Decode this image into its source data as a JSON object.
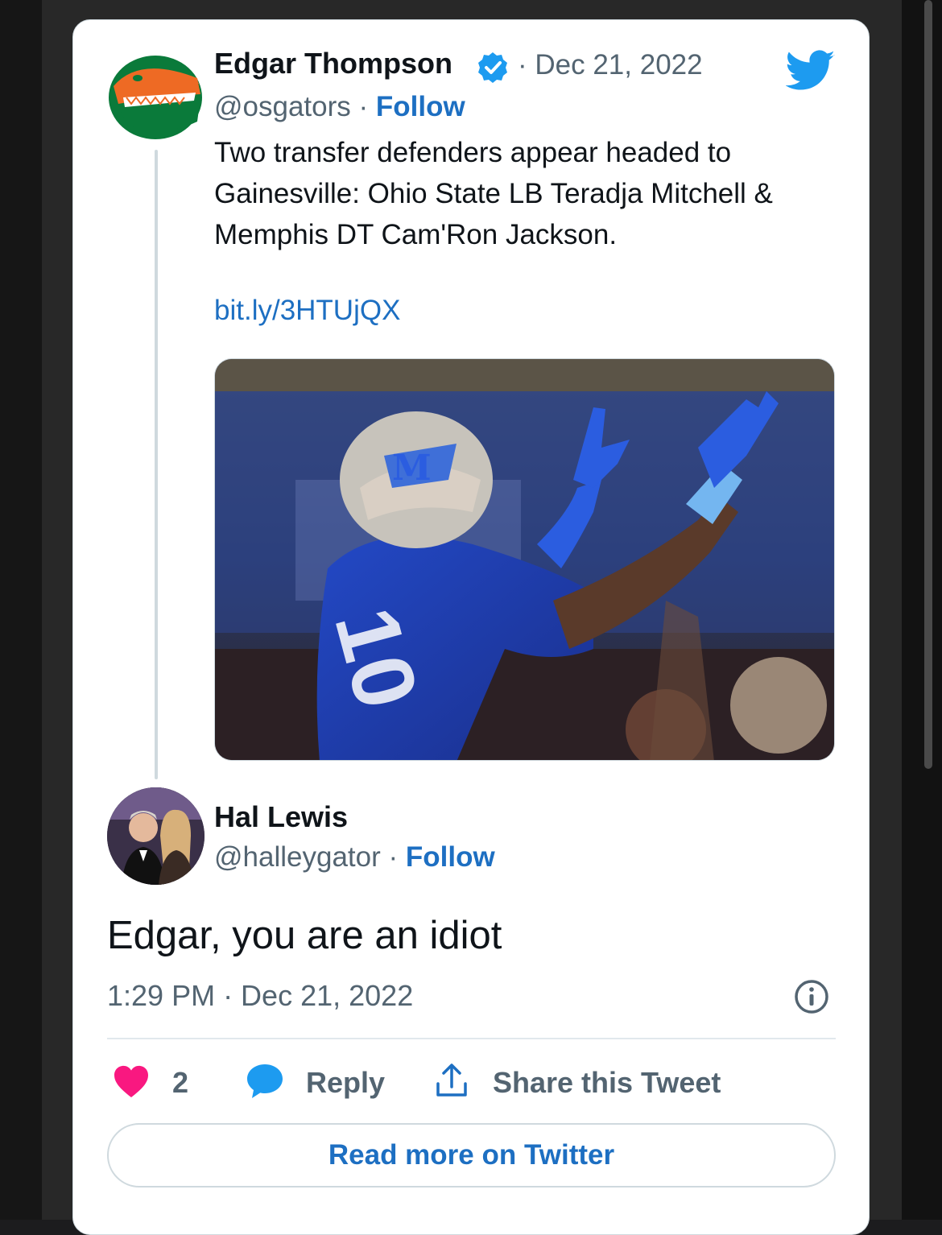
{
  "original_tweet": {
    "author_name": "Edgar Thompson",
    "date": "· Dec 21, 2022",
    "handle": "@osgators",
    "separator": " · ",
    "follow_label": "Follow",
    "text": "Two transfer defenders appear headed to Gainesville: Ohio State LB Teradja Mitchell & Memphis DT Cam'Ron Jackson.",
    "link": "bit.ly/3HTUjQX"
  },
  "reply_tweet": {
    "author_name": "Hal Lewis",
    "handle": "@halleygator",
    "separator": " · ",
    "follow_label": "Follow",
    "text": "Edgar, you are an idiot",
    "timestamp": "1:29 PM · Dec 21, 2022"
  },
  "actions": {
    "like_count": "2",
    "reply_label": "Reply",
    "share_label": "Share this Tweet"
  },
  "read_more_label": "Read more on Twitter",
  "colors": {
    "accent": "#1d6fc2",
    "twitter_blue": "#1d9bf0",
    "like": "#f91880",
    "text": "#0f1419",
    "muted": "#536471"
  },
  "icons": [
    "twitter-bird-icon",
    "verified-badge-icon",
    "info-icon",
    "heart-icon",
    "reply-bubble-icon",
    "share-icon"
  ]
}
